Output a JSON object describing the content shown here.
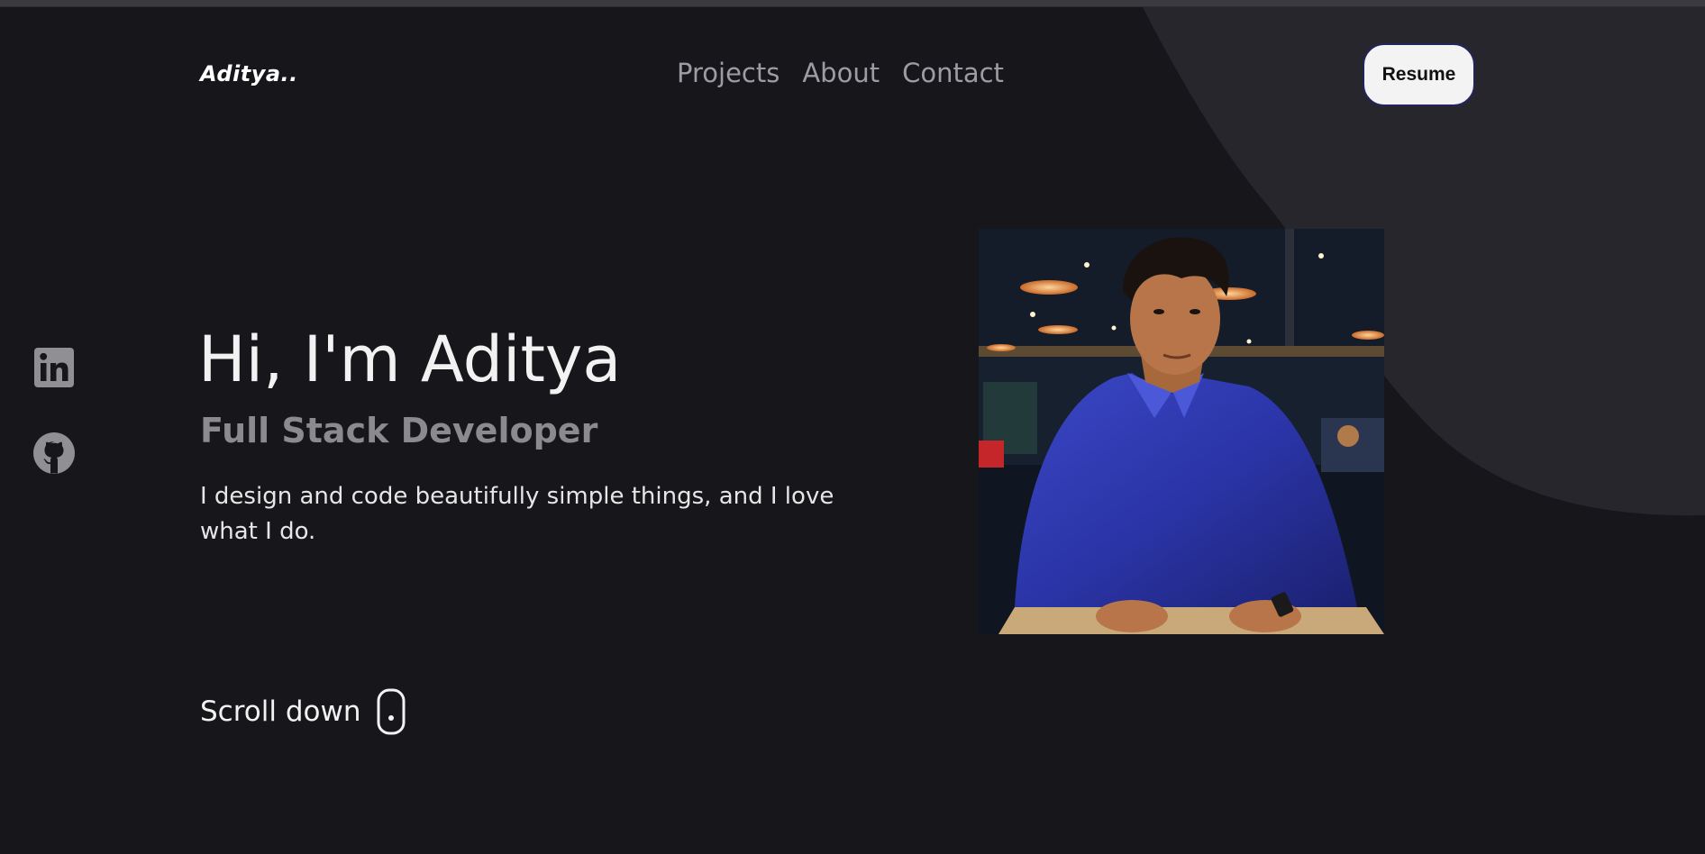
{
  "header": {
    "logo": "Aditya..",
    "nav": [
      {
        "label": "Projects"
      },
      {
        "label": "About"
      },
      {
        "label": "Contact"
      }
    ],
    "resume_label": "Resume"
  },
  "social": [
    {
      "icon": "linkedin-icon"
    },
    {
      "icon": "github-icon"
    }
  ],
  "hero": {
    "title": "Hi, I'm Aditya",
    "subtitle": "Full Stack Developer",
    "description": "I design and code beautifully simple things, and I love what I do.",
    "scroll_label": "Scroll down"
  },
  "colors": {
    "background": "#16161b",
    "blob": "#26262c",
    "nav_text": "#9d9ca3",
    "resume_bg": "#f3f3f3",
    "resume_border": "#24245c",
    "shirt_blue": "#2b35a8"
  }
}
